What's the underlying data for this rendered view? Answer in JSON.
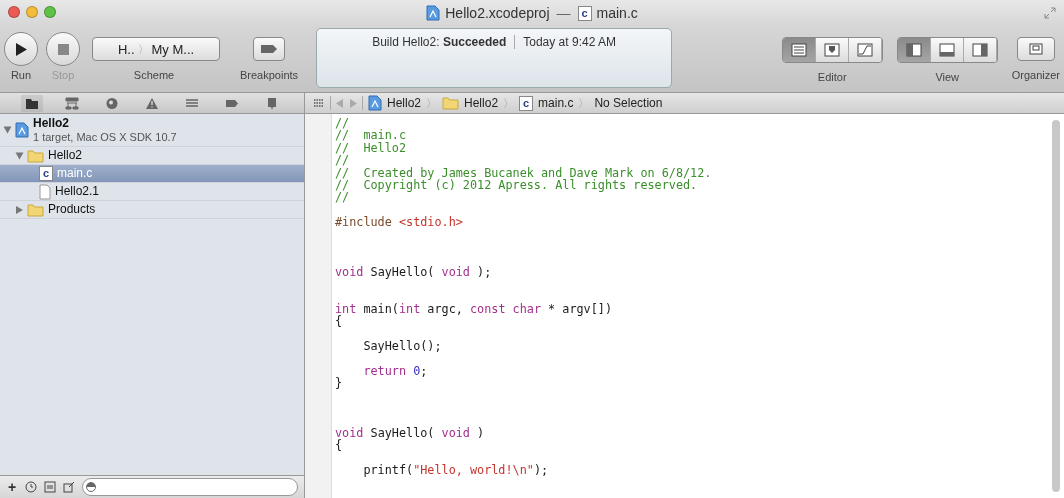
{
  "window": {
    "project": "Hello2.xcodeproj",
    "separator": "—",
    "file_badge": "c",
    "file": "main.c"
  },
  "toolbar": {
    "run": {
      "label": "Run",
      "disabled": false
    },
    "stop": {
      "label": "Stop",
      "disabled": true
    },
    "scheme": {
      "target": "H..",
      "separator": "〉",
      "destination": "My M...",
      "label": "Scheme"
    },
    "breakpoints": {
      "label": "Breakpoints"
    },
    "activity": {
      "prefix": "Build Hello2: ",
      "status": "Succeeded",
      "time": "Today at 9:42 AM"
    },
    "editor": {
      "label": "Editor",
      "segments": [
        {
          "kind": "standard",
          "selected": true
        },
        {
          "kind": "assistant",
          "selected": false
        },
        {
          "kind": "version",
          "selected": false
        }
      ]
    },
    "view": {
      "label": "View",
      "segments": [
        {
          "kind": "navigator",
          "selected": true
        },
        {
          "kind": "debug",
          "selected": false
        },
        {
          "kind": "utilities",
          "selected": false
        }
      ]
    },
    "organizer": {
      "label": "Organizer"
    }
  },
  "navigator": {
    "tabs": [
      {
        "kind": "project",
        "selected": true
      },
      {
        "kind": "symbol",
        "selected": false
      },
      {
        "kind": "search",
        "selected": false
      },
      {
        "kind": "issue",
        "selected": false
      },
      {
        "kind": "debug",
        "selected": false
      },
      {
        "kind": "breakpoint",
        "selected": false
      },
      {
        "kind": "log",
        "selected": false
      }
    ],
    "tree": [
      {
        "label": "Hello2",
        "subtitle": "1 target, Mac OS X SDK 10.7",
        "kind": "project",
        "expanded": true,
        "selected": false,
        "children": [
          {
            "label": "Hello2",
            "kind": "folder",
            "expanded": true,
            "selected": false,
            "children": [
              {
                "label": "main.c",
                "kind": "source",
                "badge": "c",
                "selected": true
              },
              {
                "label": "Hello2.1",
                "kind": "document",
                "selected": false
              }
            ]
          },
          {
            "label": "Products",
            "kind": "folder",
            "expanded": false,
            "selected": false
          }
        ]
      }
    ],
    "add_symbol": "+"
  },
  "jump_bar": {
    "crumbs": [
      {
        "label": "Hello2",
        "kind": "project"
      },
      {
        "label": "Hello2",
        "kind": "folder"
      },
      {
        "label": "main.c",
        "kind": "source",
        "badge": "c"
      },
      {
        "label": "No Selection",
        "kind": "plain"
      }
    ],
    "separator": "〉"
  },
  "code": [
    {
      "kind": "line",
      "tokens": [
        {
          "t": "//",
          "kind": "comment"
        }
      ]
    },
    {
      "kind": "line",
      "tokens": [
        {
          "t": "//  main.c",
          "kind": "comment"
        }
      ]
    },
    {
      "kind": "line",
      "tokens": [
        {
          "t": "//  Hello2",
          "kind": "comment"
        }
      ]
    },
    {
      "kind": "line",
      "tokens": [
        {
          "t": "//",
          "kind": "comment"
        }
      ]
    },
    {
      "kind": "line",
      "tokens": [
        {
          "t": "//  Created by James Bucanek and Dave Mark on 6/8/12.",
          "kind": "comment"
        }
      ]
    },
    {
      "kind": "line",
      "tokens": [
        {
          "t": "//  Copyright (c) 2012 Apress. All rights reserved.",
          "kind": "comment"
        }
      ]
    },
    {
      "kind": "line",
      "tokens": [
        {
          "t": "//",
          "kind": "comment"
        }
      ]
    },
    {
      "kind": "paragraph",
      "tokens": [
        {
          "t": "#include ",
          "kind": "preprocessor"
        },
        {
          "t": "<stdio.h>",
          "kind": "string"
        }
      ]
    },
    {
      "kind": "section",
      "tokens": [
        {
          "t": "void",
          "kind": "keyword"
        },
        {
          "t": " SayHello( ",
          "kind": "plain"
        },
        {
          "t": "void",
          "kind": "keyword"
        },
        {
          "t": " );",
          "kind": "plain"
        }
      ]
    },
    {
      "kind": "block",
      "tokens": [
        {
          "t": "int",
          "kind": "keyword"
        },
        {
          "t": " main(",
          "kind": "plain"
        },
        {
          "t": "int",
          "kind": "keyword"
        },
        {
          "t": " argc, ",
          "kind": "plain"
        },
        {
          "t": "const",
          "kind": "keyword"
        },
        {
          "t": " char",
          "kind": "keyword"
        },
        {
          "t": " * argv[])",
          "kind": "plain"
        }
      ]
    },
    {
      "kind": "line",
      "tokens": [
        {
          "t": "{",
          "kind": "plain"
        }
      ]
    },
    {
      "kind": "paragraph",
      "tokens": [
        {
          "t": "    SayHello();",
          "kind": "plain"
        }
      ]
    },
    {
      "kind": "paragraph",
      "tokens": [
        {
          "t": "    return",
          "kind": "keyword"
        },
        {
          "t": " 0",
          "kind": "number"
        },
        {
          "t": ";",
          "kind": "plain"
        }
      ]
    },
    {
      "kind": "line",
      "tokens": [
        {
          "t": "}",
          "kind": "plain"
        }
      ]
    },
    {
      "kind": "section",
      "tokens": [
        {
          "t": "void",
          "kind": "keyword"
        },
        {
          "t": " SayHello( ",
          "kind": "plain"
        },
        {
          "t": "void",
          "kind": "keyword"
        },
        {
          "t": " )",
          "kind": "plain"
        }
      ]
    },
    {
      "kind": "line",
      "tokens": [
        {
          "t": "{",
          "kind": "plain"
        }
      ]
    },
    {
      "kind": "paragraph",
      "tokens": [
        {
          "t": "    printf(",
          "kind": "plain"
        },
        {
          "t": "\"Hello, world!\\n\"",
          "kind": "string"
        },
        {
          "t": ");",
          "kind": "plain"
        }
      ]
    }
  ]
}
